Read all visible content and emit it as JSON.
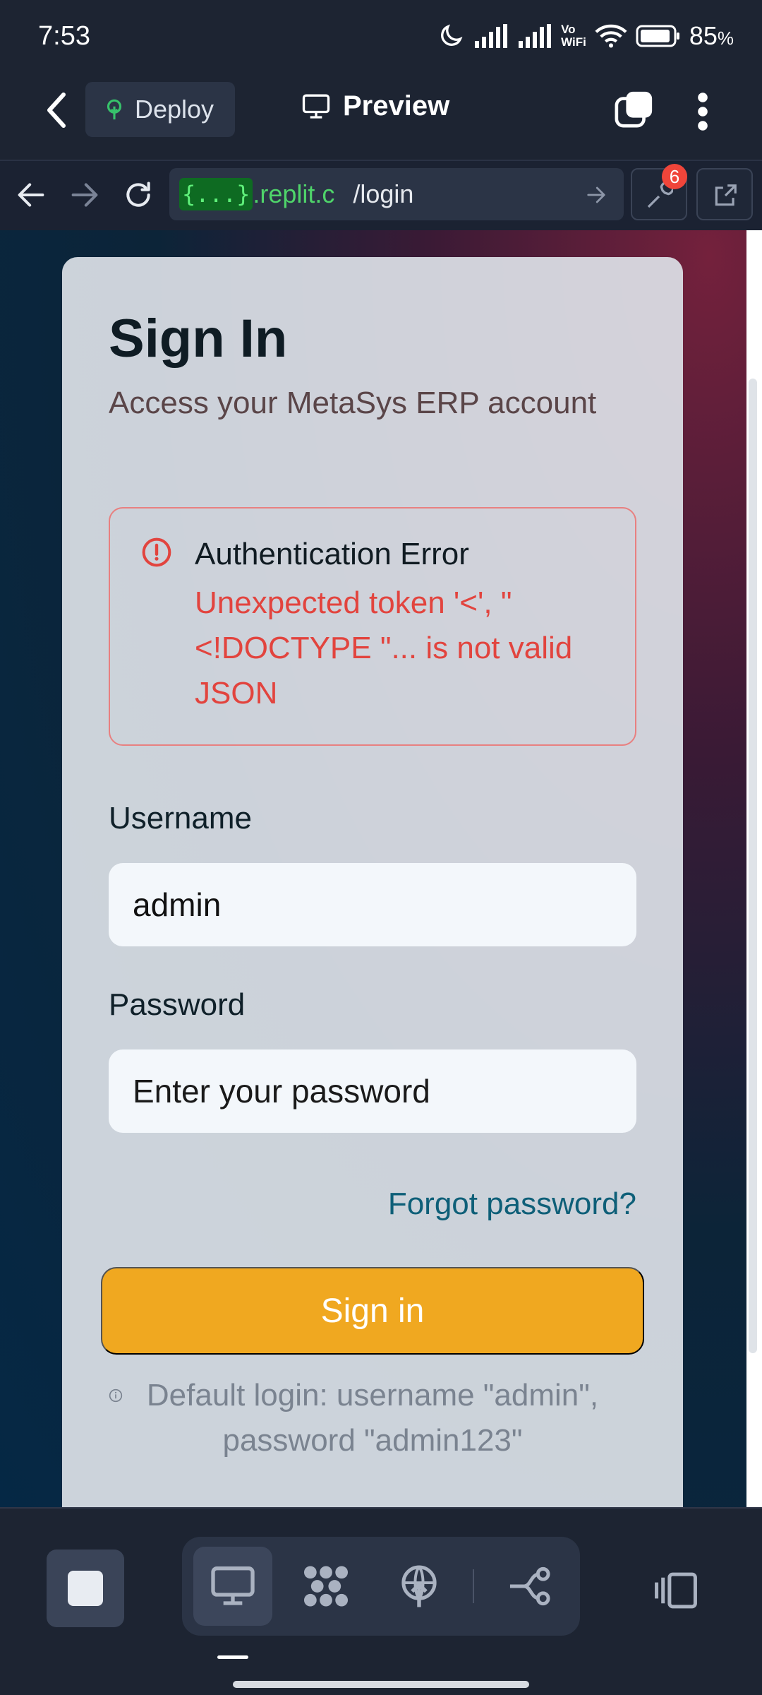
{
  "status_bar": {
    "time": "7:53",
    "battery": "85",
    "battery_suffix": "%",
    "vowifi_top": "Vo",
    "vowifi_bottom": "WiFi"
  },
  "header": {
    "deploy_label": "Deploy",
    "preview_label": "Preview"
  },
  "url_bar": {
    "host_masked": "{...}",
    "host_suffix": ".replit.c",
    "path": "/login",
    "badge_count": "6"
  },
  "login": {
    "title": "Sign In",
    "subtitle": "Access your MetaSys ERP account",
    "error_title": "Authentication Error",
    "error_message": "Unexpected token '<', \"<!DOCTYPE \"... is not valid JSON",
    "username_label": "Username",
    "username_value": "admin",
    "password_label": "Password",
    "password_placeholder": "Enter your password",
    "forgot_link": "Forgot password?",
    "submit_label": "Sign in",
    "hint": "Default login: username \"admin\", password \"admin123\""
  },
  "colors": {
    "accent": "#f0a820",
    "error": "#e2443e",
    "link": "#0e5f78"
  }
}
